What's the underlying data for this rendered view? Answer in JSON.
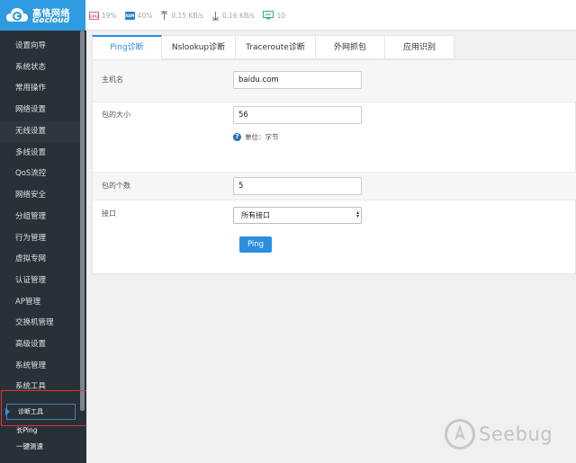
{
  "brand": {
    "name_cn": "高恪网络",
    "name_en": "Gocloud"
  },
  "status": {
    "cpu_label": "CPU",
    "cpu": "19%",
    "ram_label": "RAM",
    "ram": "40%",
    "upload": "0.15 KB/s",
    "download": "0.16 KB/s",
    "clients": "10"
  },
  "sidebar": {
    "items": [
      {
        "label": "设置向导"
      },
      {
        "label": "系统状态"
      },
      {
        "label": "常用操作"
      },
      {
        "label": "网络设置"
      },
      {
        "label": "无线设置"
      },
      {
        "label": "多线设置"
      },
      {
        "label": "QoS流控"
      },
      {
        "label": "网络安全"
      },
      {
        "label": "分组管理"
      },
      {
        "label": "行为管理"
      },
      {
        "label": "虚拟专网"
      },
      {
        "label": "认证管理"
      },
      {
        "label": "AP管理"
      },
      {
        "label": "交换机管理"
      },
      {
        "label": "高级设置"
      },
      {
        "label": "系统管理"
      },
      {
        "label": "系统工具"
      }
    ],
    "active": "诊断工具",
    "sub_items": [
      {
        "label": "长Ping"
      },
      {
        "label": "一键测速"
      }
    ]
  },
  "tabs": [
    {
      "label": "Ping诊断"
    },
    {
      "label": "Nslookup诊断"
    },
    {
      "label": "Traceroute诊断"
    },
    {
      "label": "外网抓包"
    },
    {
      "label": "应用识别"
    }
  ],
  "form": {
    "host_label": "主机名",
    "host_value": "baidu.com",
    "size_label": "包的大小",
    "size_value": "56",
    "size_hint": "单位：字节",
    "count_label": "包的个数",
    "count_value": "5",
    "iface_label": "接口",
    "iface_value": "所有接口",
    "ping_button": "Ping"
  },
  "watermark": "Seebug",
  "colors": {
    "accent": "#2a8fe0",
    "sidebar": "#283038",
    "brand": "#2f9be0",
    "highlight": "#e0352a"
  }
}
